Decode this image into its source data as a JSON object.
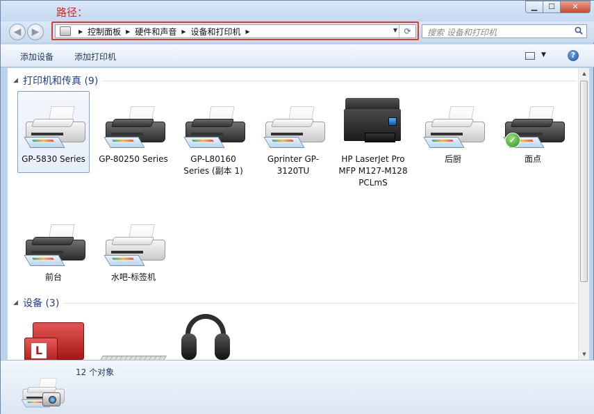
{
  "annotation": "路径：",
  "window_buttons": {
    "minimize": "▁",
    "maximize": "☐",
    "close": "✕"
  },
  "nav": {
    "back": "◀",
    "forward": "▶"
  },
  "address": {
    "crumbs": [
      "控制面板",
      "硬件和声音",
      "设备和打印机"
    ],
    "separator": "▶",
    "dropdown": "▼",
    "refresh": "⟳"
  },
  "search": {
    "placeholder": "搜索 设备和打印机"
  },
  "toolbar": {
    "add_device": "添加设备",
    "add_printer": "添加打印机",
    "view_drop": "▼",
    "help": "?"
  },
  "groups": {
    "printers": {
      "title": "打印机和传真 (9)",
      "arrow": "◢"
    },
    "devices": {
      "title": "设备 (3)",
      "arrow": "◢"
    }
  },
  "printers": [
    {
      "label": "GP-5830 Series",
      "selected": true,
      "default": false,
      "style": "light"
    },
    {
      "label": "GP-80250 Series",
      "selected": false,
      "default": false,
      "style": "dark"
    },
    {
      "label": "GP-L80160 Series (副本 1)",
      "selected": false,
      "default": false,
      "style": "dark"
    },
    {
      "label": "Gprinter GP-3120TU",
      "selected": false,
      "default": false,
      "style": "light"
    },
    {
      "label": "HP LaserJet Pro MFP M127-M128 PCLmS",
      "selected": false,
      "default": false,
      "style": "mfp"
    },
    {
      "label": "后厨",
      "selected": false,
      "default": false,
      "style": "light"
    },
    {
      "label": "面点",
      "selected": false,
      "default": true,
      "style": "dark"
    },
    {
      "label": "前台",
      "selected": false,
      "default": false,
      "style": "dark"
    },
    {
      "label": "水吧-标签机",
      "selected": false,
      "default": false,
      "style": "light"
    }
  ],
  "devices": {
    "logo_letter": "L"
  },
  "status": {
    "text": "12 个对象"
  },
  "check_mark": "✓"
}
